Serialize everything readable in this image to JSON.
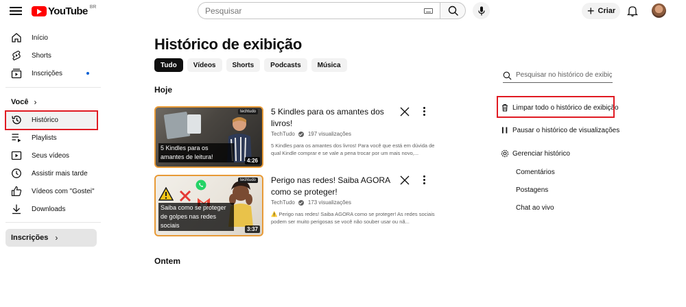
{
  "header": {
    "logo_text": "YouTube",
    "logo_country": "BR",
    "search_placeholder": "Pesquisar",
    "create_label": "Criar"
  },
  "sidebar": {
    "main": [
      {
        "label": "Início",
        "icon": "home-icon"
      },
      {
        "label": "Shorts",
        "icon": "shorts-icon"
      },
      {
        "label": "Inscrições",
        "icon": "subscriptions-icon",
        "dot": true
      }
    ],
    "you_header": "Você",
    "you": [
      {
        "label": "Histórico",
        "icon": "history-icon",
        "active": true
      },
      {
        "label": "Playlists",
        "icon": "playlist-icon"
      },
      {
        "label": "Seus vídeos",
        "icon": "your-videos-icon"
      },
      {
        "label": "Assistir mais tarde",
        "icon": "watch-later-icon"
      },
      {
        "label": "Vídeos com \"Gostei\"",
        "icon": "like-icon"
      },
      {
        "label": "Downloads",
        "icon": "download-icon"
      }
    ],
    "subscriptions_header": "Inscrições"
  },
  "main": {
    "title": "Histórico de exibição",
    "chips": [
      "Tudo",
      "Vídeos",
      "Shorts",
      "Podcasts",
      "Música"
    ],
    "active_chip": "Tudo",
    "sections": {
      "today": "Hoje",
      "yesterday": "Ontem"
    },
    "videos": [
      {
        "title": "5 Kindles para os amantes dos livros!",
        "channel": "TechTudo",
        "views": "197 visualizações",
        "description": "5 Kindles para os amantes dos livros! Para você que está em dúvida de qual Kindle comprar e se vale a pena trocar por um mais novo,...",
        "duration": "4:26",
        "thumb_caption": "5 Kindles para os amantes de leitura!",
        "thumb_brand": "techtudo"
      },
      {
        "title": "Perigo nas redes! Saiba AGORA como se proteger!",
        "channel": "TechTudo",
        "views": "173 visualizações",
        "description": "⚠️ Perigo nas redes! Saiba AGORA como se proteger! As redes sociais podem ser muito perigosas se você não souber usar ou nã...",
        "duration": "3:37",
        "thumb_caption": "Saiba como se proteger de golpes nas redes sociais",
        "thumb_brand": "techtudo"
      }
    ]
  },
  "right_panel": {
    "search_placeholder": "Pesquisar no histórico de exibiç...",
    "clear_all": "Limpar todo o histórico de exibição",
    "pause": "Pausar o histórico de visualizações",
    "manage": "Gerenciar histórico",
    "sub_items": [
      "Comentários",
      "Postagens",
      "Chat ao vivo"
    ]
  },
  "colors": {
    "brand_red": "#ff0000",
    "highlight_red": "#e01a22",
    "thumb_border": "#e89a36",
    "chip_active": "#0f0f0f",
    "notification_dot": "#065fd4"
  }
}
